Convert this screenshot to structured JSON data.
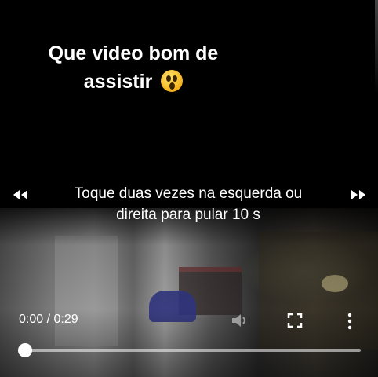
{
  "caption": {
    "line1": "Que video bom de",
    "line2": "assistir",
    "emoji": "astonished-face-icon"
  },
  "player": {
    "skip_hint_line1": "Toque duas vezes na esquerda ou",
    "skip_hint_line2": "direita para pular 10 s",
    "current_time": "0:00",
    "duration": "0:29",
    "time_display": "0:00 / 0:29",
    "progress": 0.0,
    "icons": {
      "rewind": "rewind-icon",
      "fast_forward": "fast-forward-icon",
      "volume": "volume-icon",
      "fullscreen": "fullscreen-icon",
      "more": "more-vertical-icon"
    }
  }
}
